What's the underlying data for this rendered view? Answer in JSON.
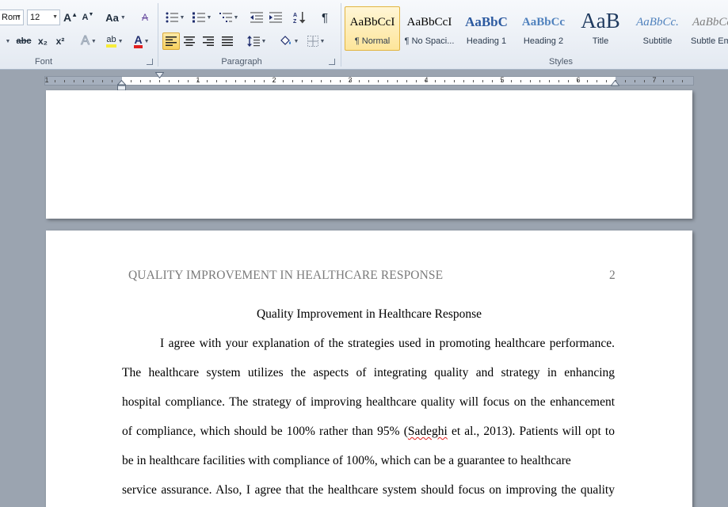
{
  "ribbon": {
    "font_group": {
      "label": "Font",
      "font_name": "Rom",
      "font_size": "12",
      "grow_glyph": "A",
      "shrink_glyph": "A",
      "case_glyph": "Aa",
      "clear_glyph": "A",
      "strike_glyph": "abc",
      "subscript_glyph": "x₂",
      "superscript_glyph": "x²",
      "effects_glyph": "A",
      "highlight_glyph": "ab",
      "font_color_glyph": "A"
    },
    "paragraph_group": {
      "label": "Paragraph",
      "pilcrow_glyph": "¶"
    },
    "styles_group": {
      "label": "Styles",
      "items": [
        {
          "preview": "AaBbCcI",
          "name": "¶ Normal"
        },
        {
          "preview": "AaBbCcI",
          "name": "¶ No Spaci..."
        },
        {
          "preview": "AaBbC",
          "name": "Heading 1"
        },
        {
          "preview": "AaBbCc",
          "name": "Heading 2"
        },
        {
          "preview": "AaB",
          "name": "Title"
        },
        {
          "preview": "AaBbCc.",
          "name": "Subtitle"
        },
        {
          "preview": "AaBbCc",
          "name": "Subtle Em"
        }
      ]
    },
    "colors": {
      "highlight": "#f7ec3a",
      "font_color": "#e02020",
      "accent_active": "#f7cf5c"
    }
  },
  "ruler": {
    "numbers": [
      "1",
      "1",
      "2",
      "3",
      "4",
      "5",
      "6",
      "7"
    ]
  },
  "document": {
    "running_head": "QUALITY IMPROVEMENT IN HEALTHCARE RESPONSE",
    "page_number": "2",
    "title": "Quality Improvement in Healthcare Response",
    "lines": [
      "I agree with your explanation of the strategies used in promoting healthcare performance.",
      "The healthcare system utilizes the aspects of integrating quality and strategy in enhancing",
      "hospital compliance. The strategy of improving healthcare quality will focus on the enhancement"
    ],
    "line4_before": "of compliance, which should be 100% rather than 95% (",
    "line4_citation_author": "Sadeghi",
    "line4_after": " et al., 2013). Patients will opt to",
    "lines_rest": [
      "be in healthcare facilities with compliance of 100%, which can be a guarantee to healthcare",
      "service assurance. Also, I agree that the healthcare system should focus on improving the quality"
    ]
  }
}
